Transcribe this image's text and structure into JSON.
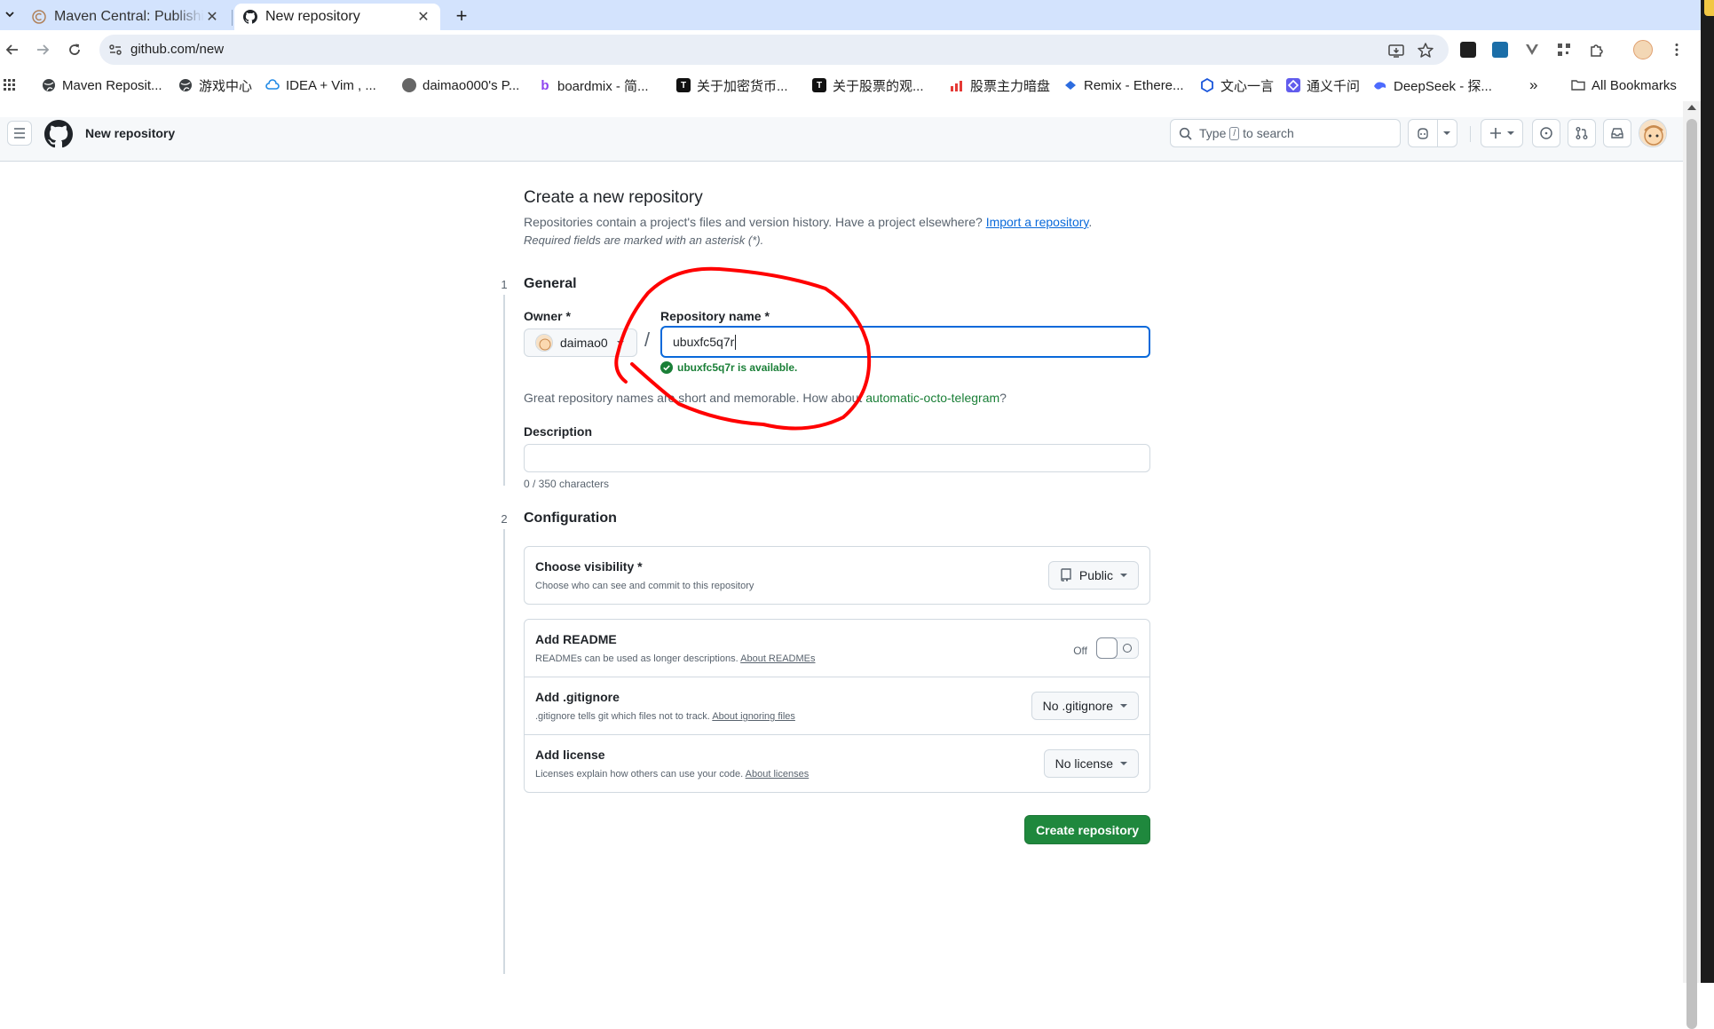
{
  "browser": {
    "tabs": [
      {
        "title": "Maven Central: Publishing",
        "close": "✕"
      },
      {
        "title": "New repository",
        "close": "✕"
      }
    ],
    "new_tab": "+",
    "url": "github.com/new",
    "bookmarks": [
      {
        "label": "Maven Reposit...",
        "icon": "globe-icon",
        "color": "#3c4043"
      },
      {
        "label": "游戏中心",
        "icon": "globe-icon",
        "color": "#3c4043"
      },
      {
        "label": "IDEA + Vim , ...",
        "icon": "cloud-icon",
        "color": "#1e88e5"
      },
      {
        "label": "daimao000's P...",
        "icon": "avatar-icon",
        "color": "#555555"
      },
      {
        "label": "boardmix - 简...",
        "icon": "b-icon",
        "color": "#8e44ef"
      },
      {
        "label": "关于加密货币...",
        "icon": "tt-icon",
        "color": "#111111"
      },
      {
        "label": "关于股票的观...",
        "icon": "tt-icon",
        "color": "#111111"
      },
      {
        "label": "股票主力暗盘",
        "icon": "chart-icon",
        "color": "#e53935"
      },
      {
        "label": "Remix - Ethere...",
        "icon": "remix-icon",
        "color": "#2d6cdf"
      },
      {
        "label": "文心一言",
        "icon": "wenxin-icon",
        "color": "#1a56db"
      },
      {
        "label": "通义千问",
        "icon": "tongyi-icon",
        "color": "#615ced"
      },
      {
        "label": "DeepSeek - 探...",
        "icon": "deepseek-icon",
        "color": "#4d6bfe"
      }
    ],
    "more_bookmarks": "»",
    "all_bookmarks": "All Bookmarks"
  },
  "header": {
    "context": "New repository",
    "search_prefix": "Type",
    "search_key": "/",
    "search_suffix": "to search"
  },
  "main": {
    "title": "Create a new repository",
    "subtitle": "Repositories contain a project's files and version history. Have a project elsewhere?",
    "import_link": "Import a repository",
    "subtitle_end": ".",
    "required_note": "Required fields are marked with an asterisk (*).",
    "general": {
      "step": "1",
      "title": "General",
      "owner_label": "Owner *",
      "owner_value": "daimao0",
      "slash": "/",
      "repo_label": "Repository name *",
      "repo_value": "ubuxfc5q7r",
      "availability": "ubuxfc5q7r is available.",
      "suggestion_text": "Great repository names are short and memorable. How about",
      "suggestion_name": "automatic-octo-telegram",
      "suggestion_end": "?",
      "description_label": "Description",
      "description_value": "",
      "char_count": "0 / 350 characters"
    },
    "configuration": {
      "step": "2",
      "title": "Configuration",
      "visibility_title": "Choose visibility *",
      "visibility_desc": "Choose who can see and commit to this repository",
      "visibility_value": "Public",
      "readme_title": "Add README",
      "readme_desc": "READMEs can be used as longer descriptions.",
      "readme_link": "About READMEs",
      "readme_state": "Off",
      "gitignore_title": "Add .gitignore",
      "gitignore_desc": ".gitignore tells git which files not to track.",
      "gitignore_link": "About ignoring files",
      "gitignore_value": "No .gitignore",
      "license_title": "Add license",
      "license_desc": "Licenses explain how others can use your code.",
      "license_link": "About licenses",
      "license_value": "No license"
    },
    "create_button": "Create repository"
  },
  "colors": {
    "accent": "#0969da",
    "success": "#1a7f37",
    "primary_button": "#1f883d",
    "annotation": "#ff0000"
  }
}
